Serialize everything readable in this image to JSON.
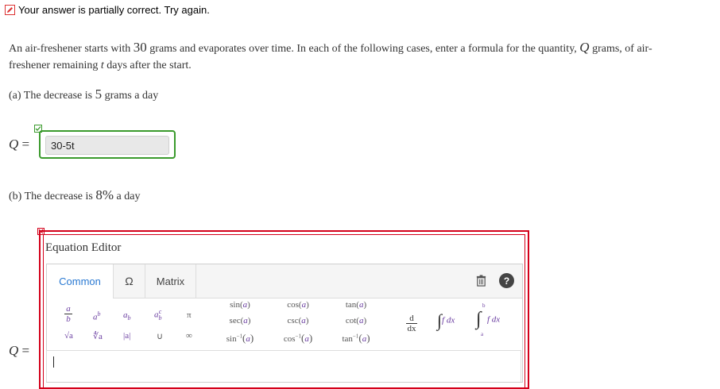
{
  "status": {
    "message": "Your answer is partially correct.  Try again.",
    "icon": "pencil-icon",
    "color": "#dd3333"
  },
  "problem": {
    "intro_1": "An air-freshener starts with ",
    "initial_amount": "30",
    "intro_2": " grams and evaporates over time. In each of the following cases, enter a formula for the quantity, ",
    "var_q": "Q",
    "intro_3": " grams, of air-freshener remaining ",
    "var_t": "t",
    "intro_4": " days after the start."
  },
  "part_a": {
    "label_1": "(a) The decrease is ",
    "amount": "5",
    "label_2": " grams a day",
    "q_symbol": "Q",
    "eq_symbol": "=",
    "answer_value": "30-5t",
    "status_color": "#3a9a2c"
  },
  "part_b": {
    "label_1": "(b) The decrease is ",
    "amount": "8%",
    "label_2": " a day",
    "q_symbol": "Q",
    "eq_symbol": "=",
    "status_color": "#d4001a"
  },
  "editor": {
    "title": "Equation Editor",
    "tabs": [
      "Common",
      "Ω",
      "Matrix"
    ],
    "active_tab": "Common",
    "accent": "#2878d2",
    "symbols": {
      "frac_num": "a",
      "frac_den": "b",
      "power_base": "a",
      "power_exp": "b",
      "sub_base": "a",
      "sub_idx": "b",
      "subsup_base": "a",
      "subsup_sup": "c",
      "subsup_sub": "b",
      "pi": "π",
      "sqrt": "√a",
      "nroot": "∜a",
      "abs": "|a|",
      "union": "∪",
      "infinity": "∞"
    },
    "functions": {
      "sin": "sin(",
      "cos": "cos(",
      "tan": "tan(",
      "sec": "sec(",
      "csc": "csc(",
      "cot": "cot(",
      "arcsin": "sin",
      "arccos": "cos",
      "arctan": "tan",
      "inverse_exp": "−1",
      "arg": "a",
      "close": ")"
    },
    "calculus": {
      "deriv_num": "d",
      "deriv_den": "dx",
      "int_indef": "f dx",
      "int_def": "f dx",
      "upper": "b",
      "lower": "a"
    }
  }
}
